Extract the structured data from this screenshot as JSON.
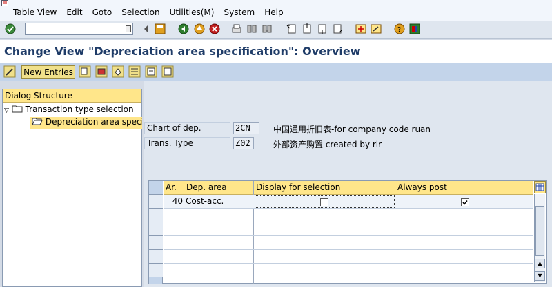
{
  "menu": {
    "items": [
      "Table View",
      "Edit",
      "Goto",
      "Selection",
      "Utilities(M)",
      "System",
      "Help"
    ]
  },
  "toolbar": {
    "command_value": "",
    "icons": [
      "enter-icon",
      "back-icon",
      "save-icon",
      "back-green-icon",
      "exit-icon",
      "cancel-icon",
      "print-icon",
      "find-icon",
      "find-next-icon",
      "first-page-icon",
      "prev-page-icon",
      "next-page-icon",
      "last-page-icon",
      "new-session-icon",
      "shortcut-icon",
      "help-icon",
      "layout-icon"
    ]
  },
  "title": "Change View \"Depreciation area specification\": Overview",
  "app_toolbar": {
    "new_entries": "New Entries"
  },
  "dialog_structure": {
    "header": "Dialog Structure",
    "items": [
      {
        "label": "Transaction type selection"
      },
      {
        "label": "Depreciation area specifi"
      }
    ]
  },
  "fields": {
    "chart_label": "Chart of dep.",
    "chart_value": "2CN",
    "chart_desc": "中国通用折旧表-for company code ruan",
    "trans_label": "Trans. Type",
    "trans_value": "Z02",
    "trans_desc": "外部资产购置 created by rlr"
  },
  "table": {
    "columns": [
      "Ar.",
      "Dep. area",
      "Display for selection",
      "Always post"
    ],
    "rows": [
      {
        "ar": "40",
        "dep_area": "Cost-acc.",
        "display": false,
        "always_post": true
      }
    ]
  }
}
